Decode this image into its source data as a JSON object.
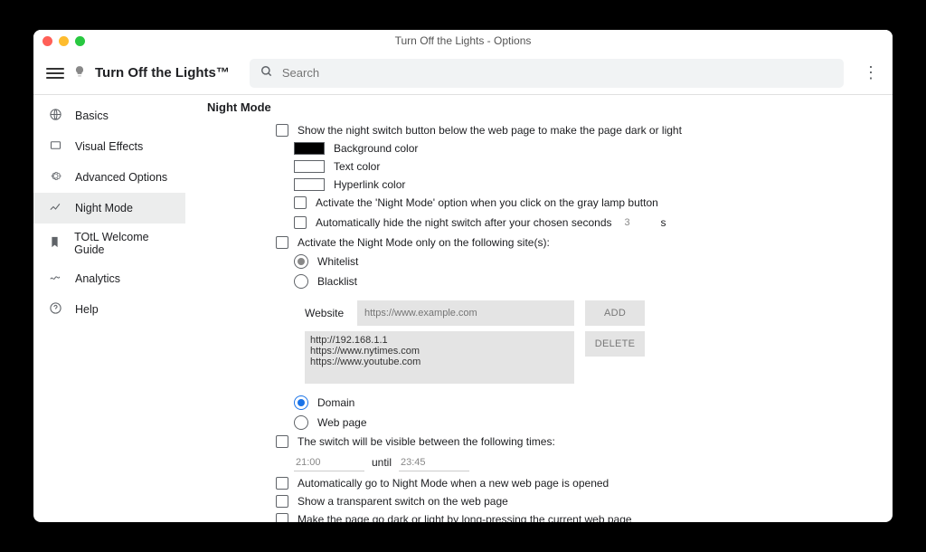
{
  "window": {
    "title": "Turn Off the Lights - Options"
  },
  "app": {
    "name": "Turn Off the Lights™"
  },
  "search": {
    "placeholder": "Search"
  },
  "sidebar": {
    "items": [
      {
        "label": "Basics",
        "icon": "globe"
      },
      {
        "label": "Visual Effects",
        "icon": "square"
      },
      {
        "label": "Advanced Options",
        "icon": "gear"
      },
      {
        "label": "Night Mode",
        "icon": "trend"
      },
      {
        "label": "TOtL Welcome Guide",
        "icon": "bookmark"
      },
      {
        "label": "Analytics",
        "icon": "wave"
      },
      {
        "label": "Help",
        "icon": "help"
      }
    ],
    "active_index": 3
  },
  "section": {
    "title": "Night Mode",
    "show_switch": "Show the night switch button below the web page to make the page dark or light",
    "bg_color": "Background color",
    "text_color": "Text color",
    "hyperlink_color": "Hyperlink color",
    "activate_lamp": "Activate the 'Night Mode' option when you click on the gray lamp button",
    "autohide": "Automatically hide the night switch after your chosen seconds",
    "autohide_seconds": "3",
    "seconds_suffix": "s",
    "only_sites": "Activate the Night Mode only on the following site(s):",
    "whitelist": "Whitelist",
    "blacklist": "Blacklist",
    "website_label": "Website",
    "website_placeholder": "https://www.example.com",
    "add": "ADD",
    "delete": "DELETE",
    "site_list": "http://192.168.1.1\nhttps://www.nytimes.com\nhttps://www.youtube.com",
    "domain": "Domain",
    "webpage": "Web page",
    "time_switch": "The switch will be visible between the following times:",
    "time_from": "21:00",
    "until": "until",
    "time_to": "23:45",
    "auto_new_page": "Automatically go to Night Mode when a new web page is opened",
    "transparent_switch": "Show a transparent switch on the web page",
    "long_press": "Make the page go dark or light by long-pressing the current web page"
  }
}
